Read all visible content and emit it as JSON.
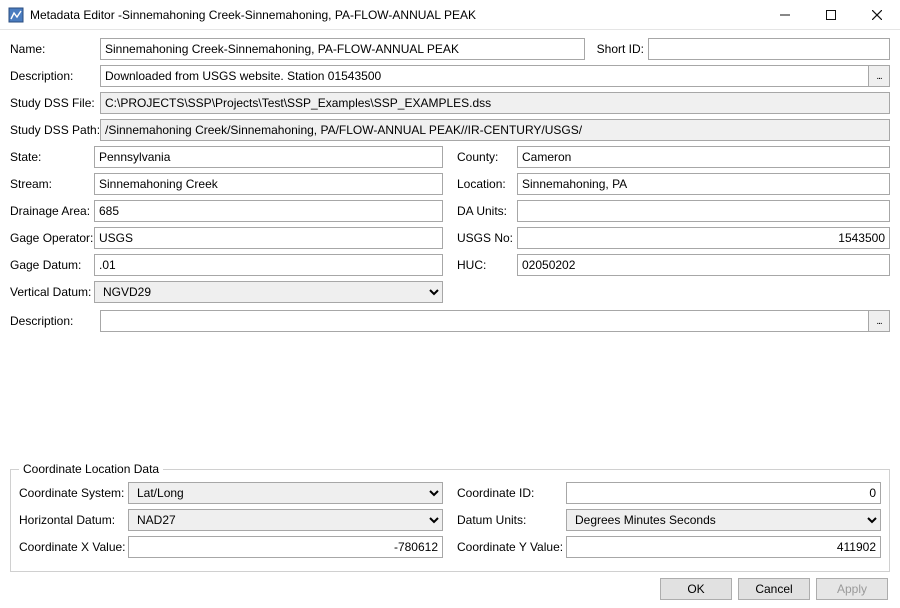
{
  "window": {
    "title": "Metadata Editor -Sinnemahoning Creek-Sinnemahoning, PA-FLOW-ANNUAL PEAK"
  },
  "labels": {
    "name": "Name:",
    "short_id": "Short ID:",
    "description": "Description:",
    "study_dss_file": "Study DSS File:",
    "study_dss_path": "Study DSS Path:",
    "state": "State:",
    "county": "County:",
    "stream": "Stream:",
    "location": "Location:",
    "drainage_area": "Drainage Area:",
    "da_units": "DA Units:",
    "gage_operator": "Gage Operator:",
    "usgs_no": "USGS No:",
    "gage_datum": "Gage Datum:",
    "huc": "HUC:",
    "vertical_datum": "Vertical Datum:",
    "description2": "Description:",
    "coord_group": "Coordinate Location Data",
    "coord_system": "Coordinate System:",
    "coord_id": "Coordinate ID:",
    "horiz_datum": "Horizontal Datum:",
    "datum_units": "Datum Units:",
    "coord_x": "Coordinate X Value:",
    "coord_y": "Coordinate Y Value:"
  },
  "fields": {
    "name": "Sinnemahoning Creek-Sinnemahoning, PA-FLOW-ANNUAL PEAK",
    "short_id": "",
    "description": "Downloaded from USGS website. Station 01543500",
    "study_dss_file": "C:\\PROJECTS\\SSP\\Projects\\Test\\SSP_Examples\\SSP_EXAMPLES.dss",
    "study_dss_path": "/Sinnemahoning Creek/Sinnemahoning, PA/FLOW-ANNUAL PEAK//IR-CENTURY/USGS/",
    "state": "Pennsylvania",
    "county": "Cameron",
    "stream": "Sinnemahoning Creek",
    "location": "Sinnemahoning, PA",
    "drainage_area": "685",
    "da_units": "",
    "gage_operator": "USGS",
    "usgs_no": "1543500",
    "gage_datum": ".01",
    "huc": "02050202",
    "vertical_datum": "NGVD29",
    "description2": "",
    "coord_system": "Lat/Long",
    "coord_id": "0",
    "horiz_datum": "NAD27",
    "datum_units": "Degrees Minutes Seconds",
    "coord_x": "-780612",
    "coord_y": "411902"
  },
  "buttons": {
    "ok": "OK",
    "cancel": "Cancel",
    "apply": "Apply",
    "ellipsis": "..."
  }
}
